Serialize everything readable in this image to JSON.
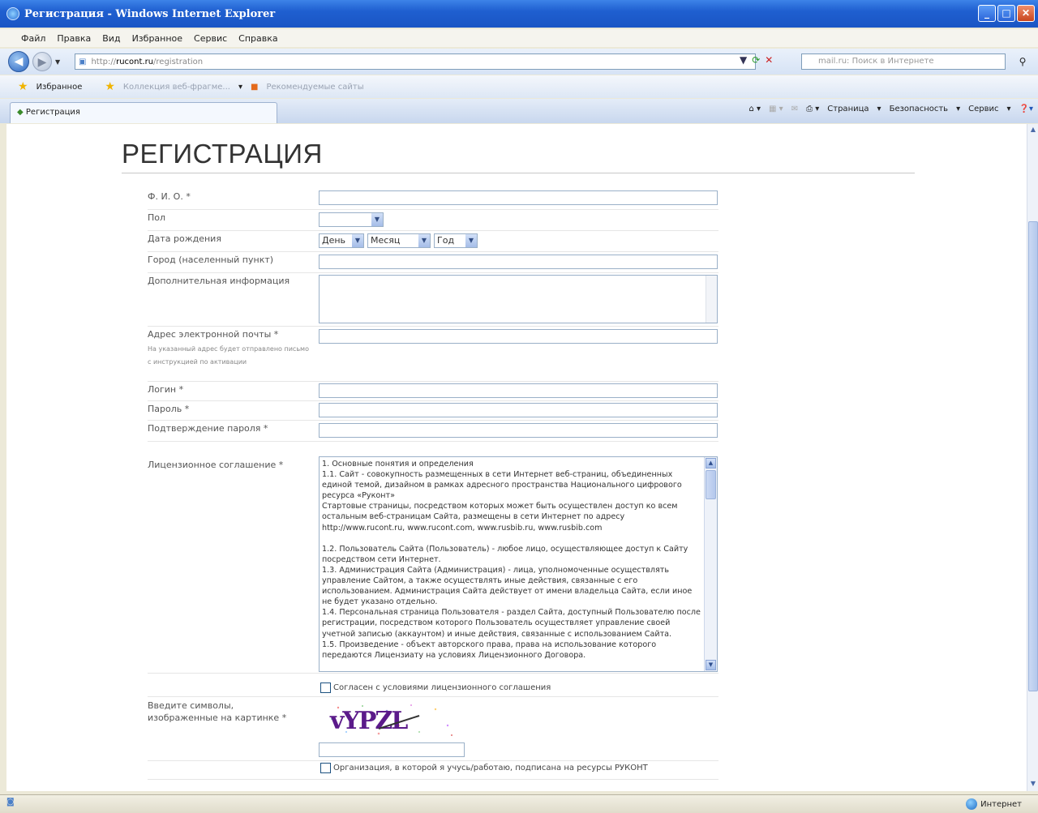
{
  "window": {
    "title": "Регистрация - Windows Internet Explorer",
    "min": "_",
    "max": "□",
    "close": "✕"
  },
  "menu": [
    "Файл",
    "Правка",
    "Вид",
    "Избранное",
    "Сервис",
    "Справка"
  ],
  "address": {
    "prefix": "http://",
    "host": "rucont.ru",
    "path": "/registration"
  },
  "search": {
    "placeholder": "mail.ru: Поиск в Интернете"
  },
  "favorites": {
    "label": "Избранное",
    "link1": "Коллекция веб-фрагме...",
    "link2": "Рекомендуемые сайты"
  },
  "tab": {
    "label": "Регистрация"
  },
  "command_bar": {
    "page": "Страница",
    "security": "Безопасность",
    "tools": "Сервис"
  },
  "page": {
    "title": "РЕГИСТРАЦИЯ",
    "fio_label": "Ф. И. О. *",
    "gender_label": "Пол",
    "birth_label": "Дата рождения",
    "day": "День",
    "month": "Месяц",
    "year": "Год",
    "city_label": "Город (населенный пункт)",
    "extra_label": "Дополнительная информация",
    "email_label": "Адрес электронной почты *",
    "email_hint": "На указанный адрес будет отправлено письмо с инструкцией по активации",
    "login_label": "Логин *",
    "password_label": "Пароль *",
    "confirm_label": "Подтверждение пароля *",
    "license_label": "Лицензионное соглашение *",
    "license_text": "1. Основные понятия и определения\n1.1. Сайт - совокупность размещенных в сети Интернет веб-страниц, объединенных единой темой, дизайном в рамках адресного пространства Национального цифрового ресурса «Руконт»\nСтартовые страницы, посредством которых может быть осуществлен доступ ко всем остальным веб-страницам Сайта, размещены в сети Интернет по адресу http://www.rucont.ru, www.rucont.com, www.rusbib.ru, www.rusbib.com\n\n1.2. Пользователь Сайта (Пользователь) - любое лицо, осуществляющее доступ к Сайту посредством сети Интернет.\n1.3. Администрация Сайта (Администрация) - лица, уполномоченные осуществлять управление Сайтом, а также осуществлять иные действия, связанные с его использованием. Администрация Сайта действует от имени владельца Сайта, если иное не будет указано отдельно.\n1.4. Персональная страница Пользователя - раздел Сайта, доступный Пользователю после регистрации, посредством которого Пользователь осуществляет управление своей учетной записью (аккаунтом) и иные действия, связанные с использованием Сайта.\n1.5. Произведение - объект авторского права, права на использование которого передаются Лицензиату на условиях Лицензионного Договора.",
    "agree_label": "Согласен с условиями лицензионного соглашения",
    "captcha_label": "Введите символы, изображенные на картинке *",
    "captcha_text": "vYPZL",
    "org_label": "Организация, в которой я учусь/работаю, подписана на ресурсы РУКОНТ"
  },
  "status": {
    "zone": "Интернет"
  }
}
